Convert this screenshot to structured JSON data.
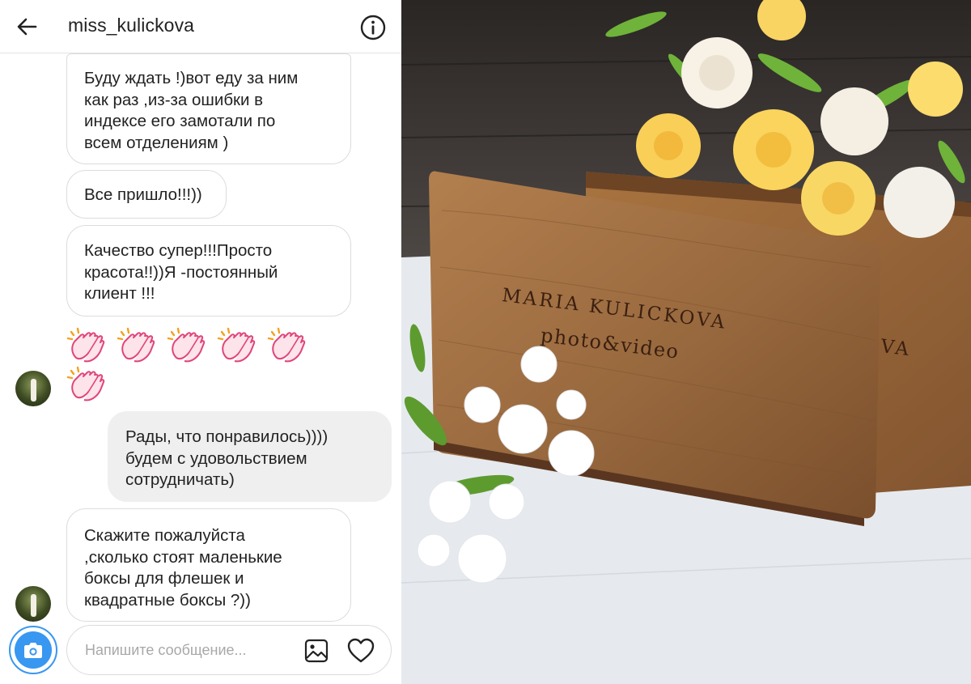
{
  "header": {
    "username": "miss_kulickova",
    "back_icon": "arrow-left-icon",
    "info_icon": "info-circle-icon"
  },
  "messages": [
    {
      "direction": "incoming",
      "text": "Буду ждать !)вот еду за ним\nкак раз ,из-за ошибки в\nиндексе его замотали по\nвсем отделениям  )"
    },
    {
      "direction": "incoming",
      "text": "Все пришло!!!))"
    },
    {
      "direction": "incoming",
      "text": "Качество супер!!!Просто\nкрасота!!))Я -постоянный\nклиент !!!"
    },
    {
      "direction": "incoming",
      "type": "emoji",
      "emoji": "clapping-hands",
      "count": 6
    },
    {
      "direction": "outgoing",
      "text": "Рады, что понравилось))))\nбудем с удовольствием\nсотрудничать)"
    },
    {
      "direction": "incoming",
      "text": "Скажите пожалуйста\n,сколько стоят маленькие\nбоксы для флешек и\nквадратные боксы ?))"
    }
  ],
  "composer": {
    "placeholder": "Напишите сообщение...",
    "camera_icon": "camera-icon",
    "gallery_icon": "image-icon",
    "heart_icon": "heart-icon"
  },
  "photo": {
    "engraving_name": "MARIA KULICKOVA",
    "engraving_sub": "photo&video",
    "engraving_back": "VA"
  },
  "colors": {
    "accent": "#3897f0",
    "outgoing_bubble": "#efefef",
    "wood": "#9a6a3f"
  }
}
